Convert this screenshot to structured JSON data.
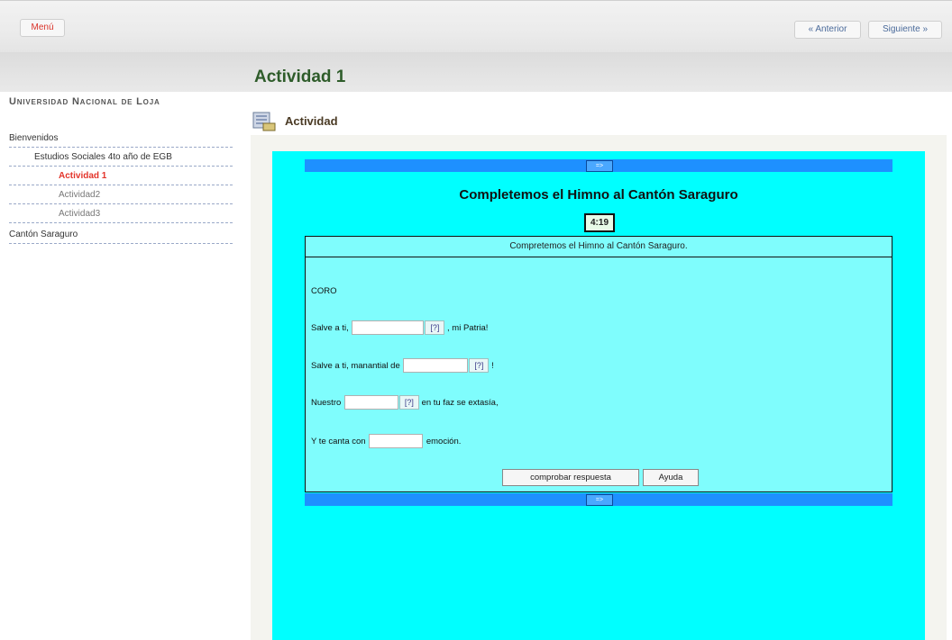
{
  "topbar": {
    "menu": "Menú",
    "prev": "« Anterior",
    "next": "Siguiente »"
  },
  "page": {
    "title": "Actividad 1"
  },
  "sidebar": {
    "university": "Universidad Nacional de Loja",
    "items": [
      {
        "label": "Bienvenidos"
      },
      {
        "label": "Estudios Sociales 4to año de EGB"
      },
      {
        "label": "Actividad 1"
      },
      {
        "label": "Actividad2"
      },
      {
        "label": "Actividad3"
      },
      {
        "label": "Cantón Saraguro"
      }
    ]
  },
  "activity": {
    "header": "Actividad",
    "nav_arrow": "=>",
    "game_title": "Completemos el Himno al Cantón Saraguro",
    "timer": "4:19",
    "instruction": "Compretemos el Himno al Cantón Saraguro.",
    "section": "CORO",
    "lines": [
      {
        "before": "Salve a ti,",
        "hint": "[?]",
        "after": ", mi Patria!"
      },
      {
        "before": "Salve a ti, manantial de",
        "hint": "[?]",
        "after": "!"
      },
      {
        "before": "Nuestro",
        "hint": "[?]",
        "after": "en tu faz se extasía,"
      },
      {
        "before": "Y te canta con",
        "after": "emoción."
      }
    ],
    "check_button": "comprobar respuesta",
    "help_button": "Ayuda"
  },
  "colors": {
    "cyan": "#00ffff",
    "blue_bar": "#1e90ff",
    "title_green": "#2e5c2a",
    "active_red": "#e3342a"
  },
  "icons": {
    "activity": "activity-doc-icon",
    "arrow": "arrow-right-icon"
  }
}
